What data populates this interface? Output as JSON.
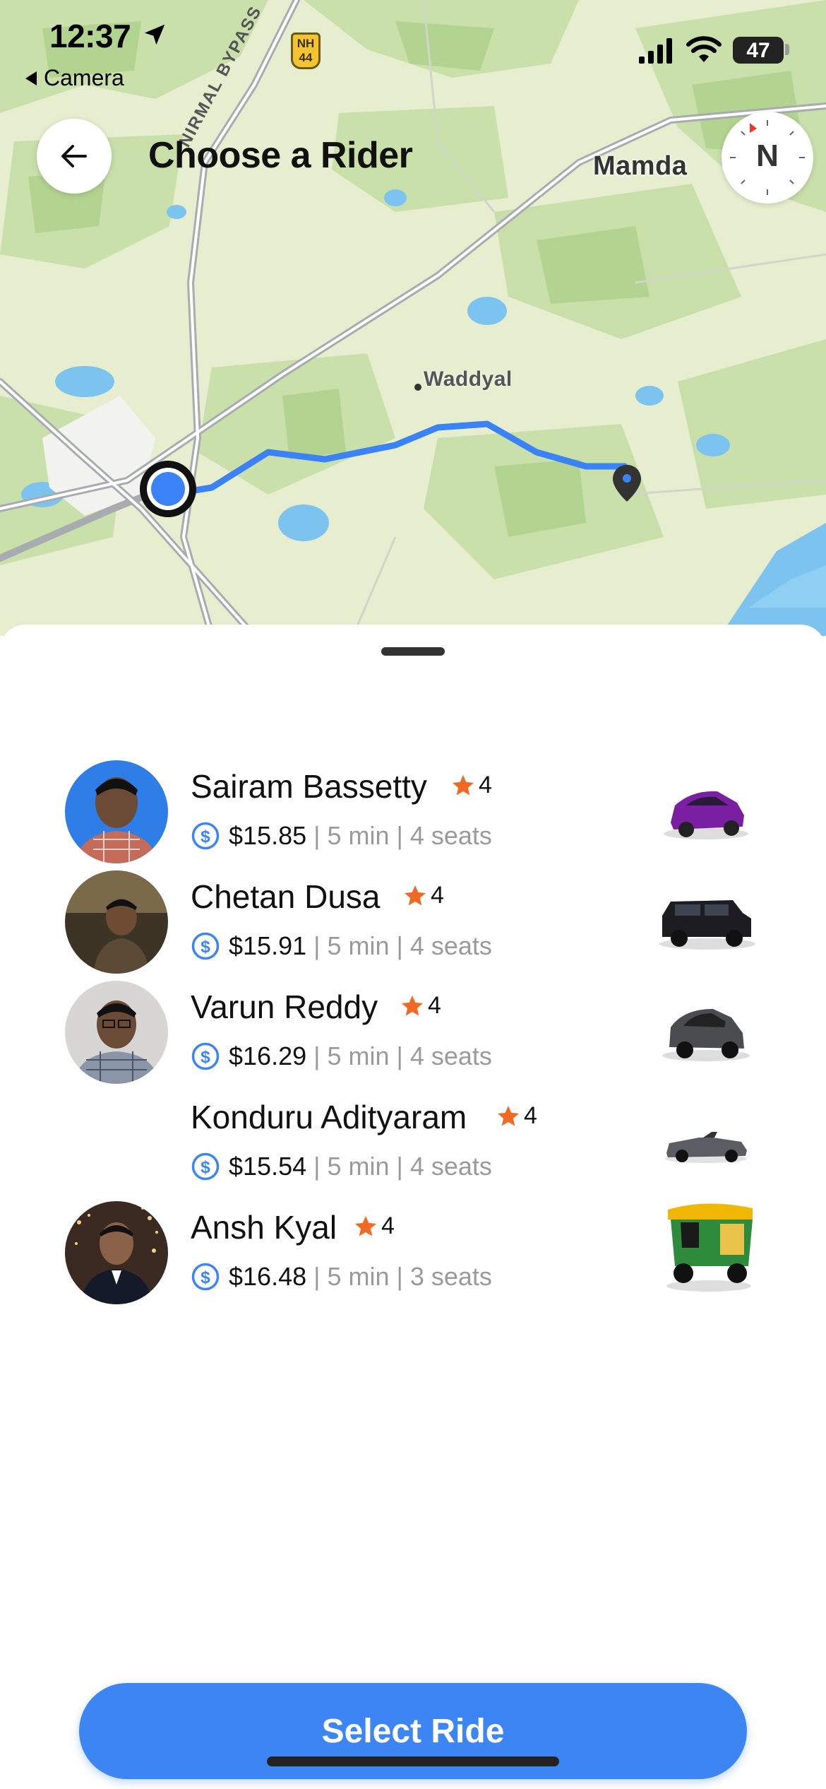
{
  "status_bar": {
    "time": "12:37",
    "back_app": "Camera",
    "battery": "47"
  },
  "header": {
    "title": "Choose a Rider"
  },
  "map": {
    "labels": {
      "town": "Mamda",
      "village": "Waddyal",
      "road": "NIRMAL BYPASS",
      "highway": "NH 44"
    },
    "compass": "N",
    "route_color": "#3b82f6"
  },
  "riders": [
    {
      "name": "Sairam Bassetty",
      "rating": "4",
      "price": "$15.85",
      "eta": "5 min",
      "seats": "4 seats",
      "vehicle": "purple-hatchback"
    },
    {
      "name": "Chetan Dusa",
      "rating": "4",
      "price": "$15.91",
      "eta": "5 min",
      "seats": "4 seats",
      "vehicle": "black-suv"
    },
    {
      "name": "Varun Reddy",
      "rating": "4",
      "price": "$16.29",
      "eta": "5 min",
      "seats": "4 seats",
      "vehicle": "grey-hatchback"
    },
    {
      "name": "Konduru Adityaram",
      "rating": "4",
      "price": "$15.54",
      "eta": "5 min",
      "seats": "4 seats",
      "vehicle": "grey-convertible"
    },
    {
      "name": "Ansh Kyal",
      "rating": "4",
      "price": "$16.48",
      "eta": "5 min",
      "seats": "3 seats",
      "vehicle": "auto-rickshaw"
    }
  ],
  "actions": {
    "select_ride": "Select Ride"
  },
  "colors": {
    "accent": "#3d85f2",
    "star": "#f06a25"
  }
}
